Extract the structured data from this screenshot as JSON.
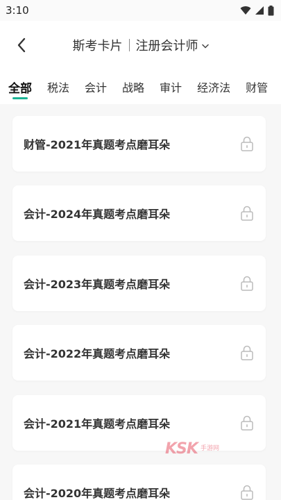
{
  "status_bar": {
    "time": "3:10"
  },
  "nav": {
    "title": "斯考卡片",
    "exam": "注册会计师"
  },
  "tabs": [
    {
      "label": "全部",
      "active": true
    },
    {
      "label": "税法",
      "active": false
    },
    {
      "label": "会计",
      "active": false
    },
    {
      "label": "战略",
      "active": false
    },
    {
      "label": "审计",
      "active": false
    },
    {
      "label": "经济法",
      "active": false
    },
    {
      "label": "财管",
      "active": false
    }
  ],
  "cards": [
    {
      "title": "财管-2021年真题考点磨耳朵",
      "locked": true
    },
    {
      "title": "会计-2024年真题考点磨耳朵",
      "locked": true
    },
    {
      "title": "会计-2023年真题考点磨耳朵",
      "locked": true
    },
    {
      "title": "会计-2022年真题考点磨耳朵",
      "locked": true
    },
    {
      "title": "会计-2021年真题考点磨耳朵",
      "locked": true
    },
    {
      "title": "会计-2020年真题考点磨耳朵",
      "locked": true
    }
  ],
  "watermark": {
    "logo": "KSK",
    "text": "手游网"
  },
  "colors": {
    "accent": "#1ab394",
    "background": "#f7f7f7",
    "card": "#ffffff"
  }
}
